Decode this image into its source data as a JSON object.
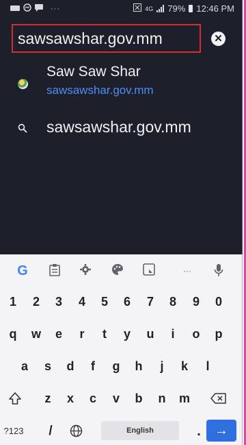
{
  "status_bar": {
    "left_icons": [
      "cast-icon",
      "messenger-icon",
      "message-icon"
    ],
    "dots": "···",
    "data_label": "4G",
    "battery_percent": "79%",
    "time": "12:46 PM"
  },
  "address_bar": {
    "url": "sawsawshar.gov.mm",
    "clear_icon": "close-icon"
  },
  "suggestions": [
    {
      "title": "Saw Saw Shar",
      "url": "sawsawshar.gov.mm",
      "icon": "site-favicon"
    },
    {
      "text": "sawsawshar.gov.mm",
      "icon": "search-icon"
    }
  ],
  "keyboard": {
    "toolbar": [
      "google-icon",
      "clipboard-icon",
      "settings-icon",
      "palette-icon",
      "translate-icon",
      "more-icon",
      "mic-icon"
    ],
    "more_label": "···",
    "number_row": [
      "1",
      "2",
      "3",
      "4",
      "5",
      "6",
      "7",
      "8",
      "9",
      "0"
    ],
    "row1": [
      "q",
      "w",
      "e",
      "r",
      "t",
      "y",
      "u",
      "i",
      "o",
      "p"
    ],
    "row2": [
      "a",
      "s",
      "d",
      "f",
      "g",
      "h",
      "j",
      "k",
      "l"
    ],
    "row3": [
      "z",
      "x",
      "c",
      "v",
      "b",
      "n",
      "m"
    ],
    "symbols_key": "?123",
    "slash_key": "/",
    "space_label": "English",
    "period_key": ".",
    "enter_icon": "arrow-right-icon"
  },
  "colors": {
    "background": "#1d1f2b",
    "url_highlight_border": "#d32f2f",
    "link_blue": "#4f8df5",
    "enter_key": "#2f6fe0"
  }
}
